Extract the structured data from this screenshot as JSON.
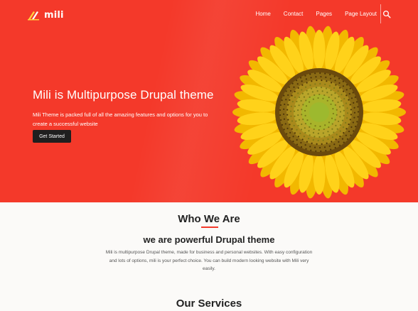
{
  "header": {
    "logo_text": "mili",
    "nav": [
      "Home",
      "Contact",
      "Pages",
      "Page Layout"
    ]
  },
  "hero": {
    "title": "Mili is Multipurpose Drupal theme",
    "description": "Mili Theme is packed full of all the amazing features and options for you to create a successful website",
    "button_label": "Get Started",
    "background_color": "#f4392a"
  },
  "who": {
    "title": "Who We Are",
    "subtitle": "we are powerful Drupal theme",
    "description": "Mili is multipurpose Drupal theme, made for business and personal websites. With easy configuration and lots of options, mili is your perfect choice. You can build modern looking website with Mili very easily."
  },
  "services": {
    "title": "Our Services"
  },
  "icons": [
    "logo-mark-icon",
    "search-icon",
    "sunflower-image"
  ]
}
